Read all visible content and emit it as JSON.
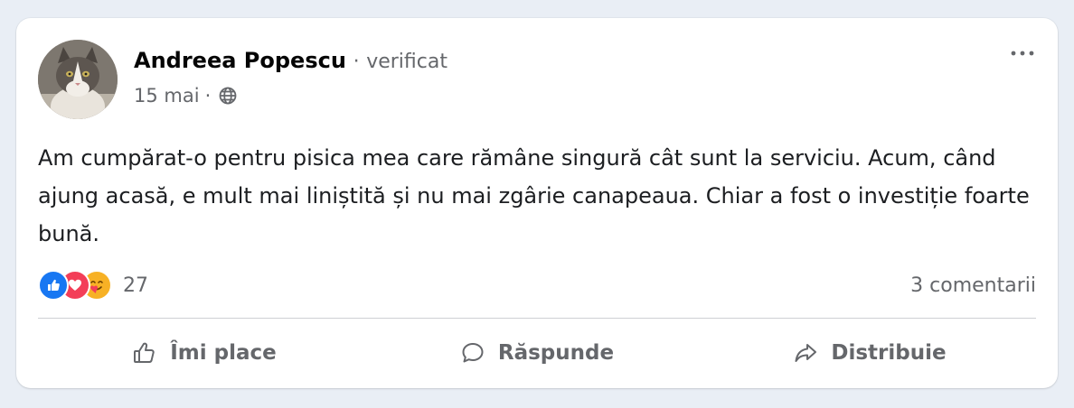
{
  "post": {
    "author": {
      "name": "Andreea Popescu",
      "separator": "·",
      "badge": "verificat"
    },
    "date": "15 mai",
    "date_separator": "·",
    "audience_icon": "globe-icon",
    "more_icon": "more-options-icon",
    "text": "Am cumpărat-o pentru pisica mea care rămâne singură cât sunt la serviciu. Acum, când ajung acasă, e mult mai liniștită și nu mai zgârie canapeaua. Chiar a fost o investiție foarte bună."
  },
  "reactions": {
    "icons": [
      "like-icon",
      "love-icon",
      "care-icon"
    ],
    "count": "27"
  },
  "comments": {
    "label": "3 comentarii"
  },
  "actions": {
    "like_label": "Îmi place",
    "reply_label": "Răspunde",
    "share_label": "Distribuie"
  },
  "colors": {
    "like": "#1877f2",
    "love": "#f33e58",
    "care": "#f7b125",
    "secondary_text": "#65676b"
  }
}
